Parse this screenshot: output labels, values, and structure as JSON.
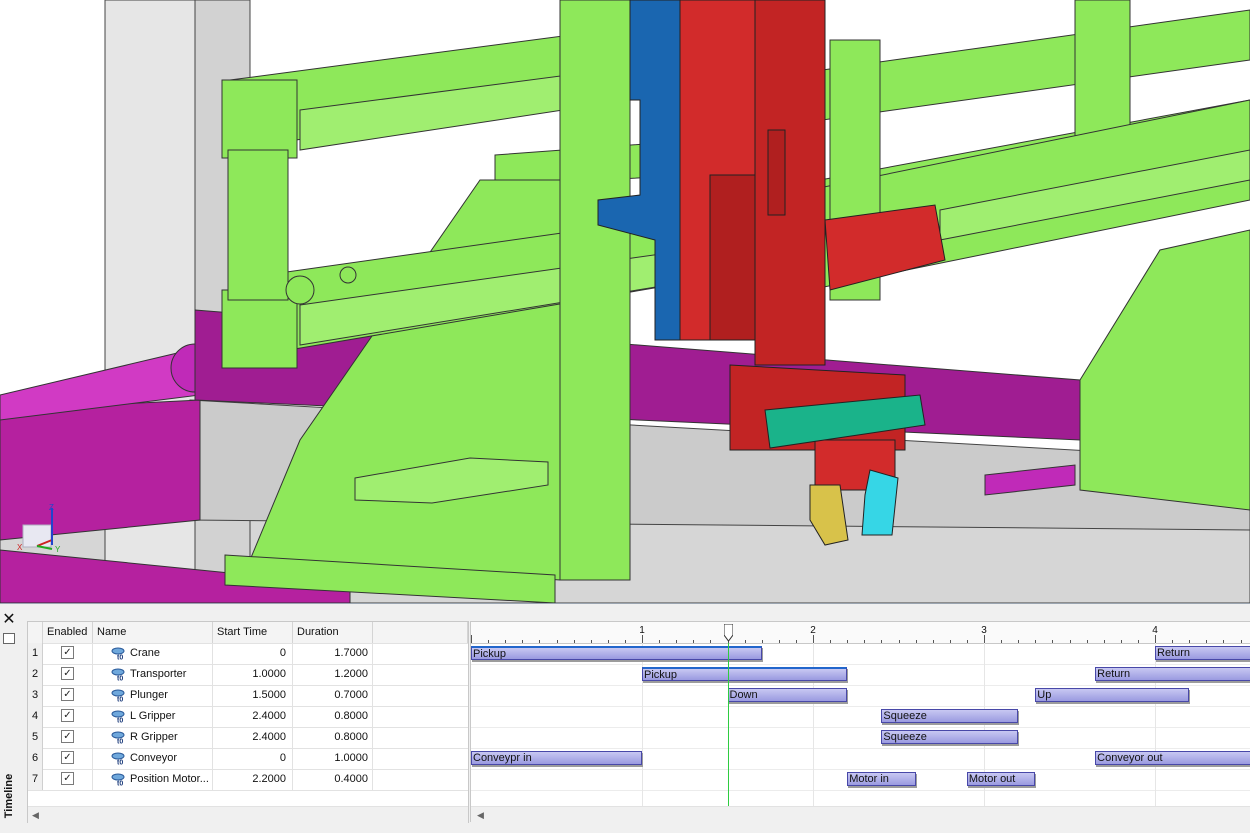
{
  "timeline": {
    "title": "Timeline",
    "close_symbol": "✕",
    "columns": {
      "num": "",
      "enabled": "Enabled",
      "name": "Name",
      "start": "Start Time",
      "duration": "Duration"
    },
    "rows": [
      {
        "num": "1",
        "enabled": true,
        "name": "Crane",
        "start": "0",
        "duration": "1.7000"
      },
      {
        "num": "2",
        "enabled": true,
        "name": "Transporter",
        "start": "1.0000",
        "duration": "1.2000"
      },
      {
        "num": "3",
        "enabled": true,
        "name": "Plunger",
        "start": "1.5000",
        "duration": "0.7000"
      },
      {
        "num": "4",
        "enabled": true,
        "name": "L Gripper",
        "start": "2.4000",
        "duration": "0.8000"
      },
      {
        "num": "5",
        "enabled": true,
        "name": "R Gripper",
        "start": "2.4000",
        "duration": "0.8000"
      },
      {
        "num": "6",
        "enabled": true,
        "name": "Conveyor",
        "start": "0",
        "duration": "1.0000"
      },
      {
        "num": "7",
        "enabled": true,
        "name": "Position Motor...",
        "start": "2.2000",
        "duration": "0.4000"
      }
    ],
    "ruler": {
      "ticks": [
        "1",
        "2",
        "3",
        "4"
      ],
      "major_values": [
        1,
        2,
        3,
        4
      ],
      "playhead_time": 1.5
    },
    "bars": [
      {
        "row": 0,
        "label": "Pickup",
        "start": 0,
        "end": 1.7,
        "selected": true
      },
      {
        "row": 0,
        "label": "Return",
        "start": 4.0,
        "end": 4.6,
        "selected": false
      },
      {
        "row": 1,
        "label": "Pickup",
        "start": 1.0,
        "end": 2.2,
        "selected": true
      },
      {
        "row": 1,
        "label": "Return",
        "start": 3.65,
        "end": 4.6,
        "selected": false
      },
      {
        "row": 2,
        "label": "Down",
        "start": 1.5,
        "end": 2.2,
        "selected": false
      },
      {
        "row": 2,
        "label": "Up",
        "start": 3.3,
        "end": 4.2,
        "selected": false
      },
      {
        "row": 3,
        "label": "Squeeze",
        "start": 2.4,
        "end": 3.2,
        "selected": false
      },
      {
        "row": 4,
        "label": "Squeeze",
        "start": 2.4,
        "end": 3.2,
        "selected": false
      },
      {
        "row": 5,
        "label": "Conveypr in",
        "start": 0,
        "end": 1.0,
        "selected": false
      },
      {
        "row": 5,
        "label": "Conveyor out",
        "start": 3.65,
        "end": 4.6,
        "selected": false
      },
      {
        "row": 6,
        "label": "Motor in",
        "start": 2.2,
        "end": 2.6,
        "selected": false
      },
      {
        "row": 6,
        "label": "Motor out",
        "start": 2.9,
        "end": 3.3,
        "selected": false
      }
    ]
  },
  "viewport": {
    "triad_axes": [
      "X",
      "Y",
      "Z"
    ],
    "colors": {
      "frame_green": "#8ee85a",
      "frame_green_dark": "#5fb23a",
      "crane_red": "#d22b2b",
      "crane_red_dark": "#9e1c1c",
      "carriage_blue": "#1a66b0",
      "conveyor_magenta": "#c02ab8",
      "gripper_teal": "#1ab38a",
      "finger_yellow": "#d8c24a",
      "finger_cyan": "#36d6e6",
      "floor_gray": "#c8c8c8"
    }
  }
}
